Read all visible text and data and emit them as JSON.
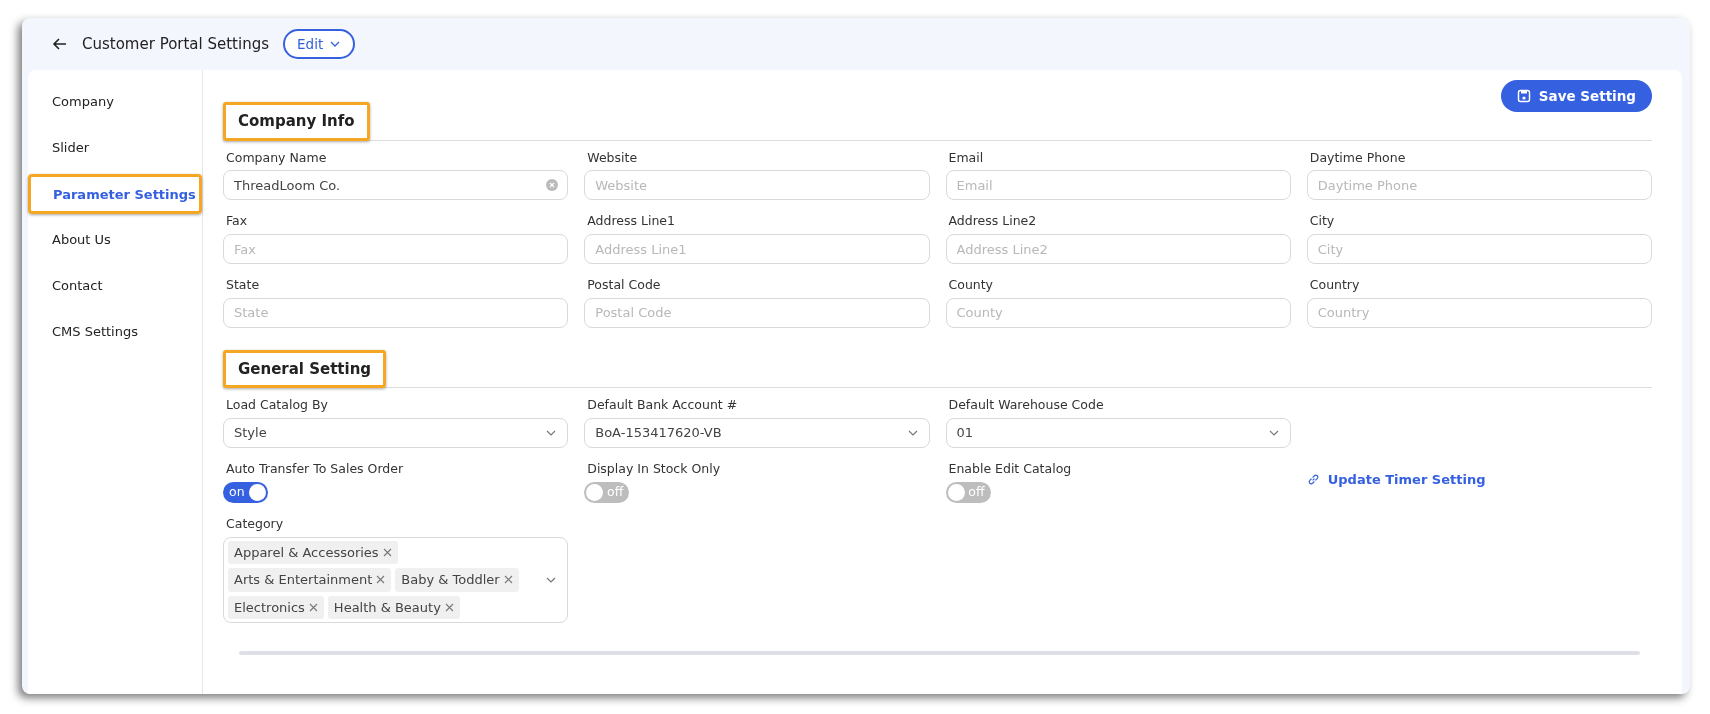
{
  "header": {
    "title": "Customer Portal Settings",
    "edit_button": "Edit"
  },
  "sidebar": {
    "items": [
      {
        "label": "Company",
        "selected": false,
        "highlighted": false
      },
      {
        "label": "Slider",
        "selected": false,
        "highlighted": false
      },
      {
        "label": "Parameter Settings",
        "selected": true,
        "highlighted": true
      },
      {
        "label": "About Us",
        "selected": false,
        "highlighted": false
      },
      {
        "label": "Contact",
        "selected": false,
        "highlighted": false
      },
      {
        "label": "CMS Settings",
        "selected": false,
        "highlighted": false
      }
    ]
  },
  "save_button": "Save Setting",
  "sections": [
    {
      "title": "Company Info",
      "highlighted": true,
      "rows": [
        [
          {
            "kind": "text",
            "label": "Company Name",
            "value": "ThreadLoom Co.",
            "clearable": true
          },
          {
            "kind": "text",
            "label": "Website",
            "placeholder": "Website"
          },
          {
            "kind": "text",
            "label": "Email",
            "placeholder": "Email"
          },
          {
            "kind": "text",
            "label": "Daytime Phone",
            "placeholder": "Daytime Phone"
          }
        ],
        [
          {
            "kind": "text",
            "label": "Fax",
            "placeholder": "Fax"
          },
          {
            "kind": "text",
            "label": "Address Line1",
            "placeholder": "Address Line1"
          },
          {
            "kind": "text",
            "label": "Address Line2",
            "placeholder": "Address Line2"
          },
          {
            "kind": "text",
            "label": "City",
            "placeholder": "City"
          }
        ],
        [
          {
            "kind": "text",
            "label": "State",
            "placeholder": "State"
          },
          {
            "kind": "text",
            "label": "Postal Code",
            "placeholder": "Postal Code"
          },
          {
            "kind": "text",
            "label": "County",
            "placeholder": "County"
          },
          {
            "kind": "text",
            "label": "Country",
            "placeholder": "Country"
          }
        ]
      ]
    },
    {
      "title": "General Setting",
      "highlighted": true,
      "rows": [
        [
          {
            "kind": "select",
            "label": "Load Catalog By",
            "value": "Style"
          },
          {
            "kind": "select",
            "label": "Default Bank Account #",
            "value": "BoA-153417620-VB"
          },
          {
            "kind": "select",
            "label": "Default Warehouse Code",
            "value": "01"
          }
        ],
        [
          {
            "kind": "switch",
            "label": "Auto Transfer To Sales Order",
            "on": true,
            "state_text": "on"
          },
          {
            "kind": "switch",
            "label": "Display In Stock Only",
            "on": false,
            "state_text": "off"
          },
          {
            "kind": "switch",
            "label": "Enable Edit Catalog",
            "on": false,
            "state_text": "off"
          },
          {
            "kind": "link",
            "text": "Update Timer Setting"
          }
        ],
        [
          {
            "kind": "multiselect",
            "label": "Category",
            "tags": [
              "Apparel & Accessories",
              "Arts & Entertainment",
              "Baby & Toddler",
              "Electronics",
              "Health & Beauty"
            ]
          }
        ]
      ]
    }
  ]
}
